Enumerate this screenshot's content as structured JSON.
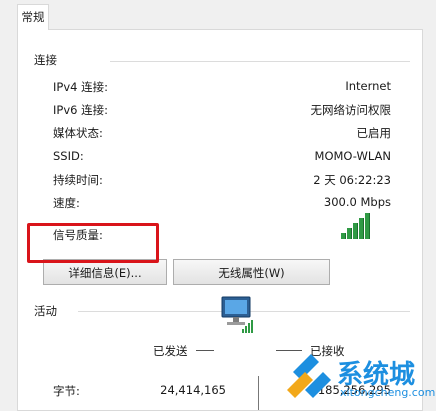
{
  "tab": {
    "label": "常规"
  },
  "connection": {
    "title": "连接",
    "rows": [
      {
        "label": "IPv4 连接:",
        "value": "Internet"
      },
      {
        "label": "IPv6 连接:",
        "value": "无网络访问权限"
      },
      {
        "label": "媒体状态:",
        "value": "已启用"
      },
      {
        "label": "SSID:",
        "value": "MOMO-WLAN"
      },
      {
        "label": "持续时间:",
        "value": "2 天 06:22:23"
      },
      {
        "label": "速度:",
        "value": "300.0 Mbps"
      }
    ],
    "signal_label": "信号质量:",
    "signal_level": 1.0
  },
  "buttons": {
    "details": "详细信息(E)...",
    "wireless": "无线属性(W)"
  },
  "activity": {
    "title": "活动",
    "sent_label": "已发送",
    "received_label": "已接收",
    "bytes_label": "字节:",
    "bytes_sent": "24,414,165",
    "bytes_received": "185,256,295"
  },
  "watermark": {
    "brand": "系统城",
    "url": "xitongcheng.com"
  },
  "colors": {
    "highlight": "#d9141a",
    "signal": "#2f9a44",
    "watermark_blue": "#1d8fe0"
  }
}
